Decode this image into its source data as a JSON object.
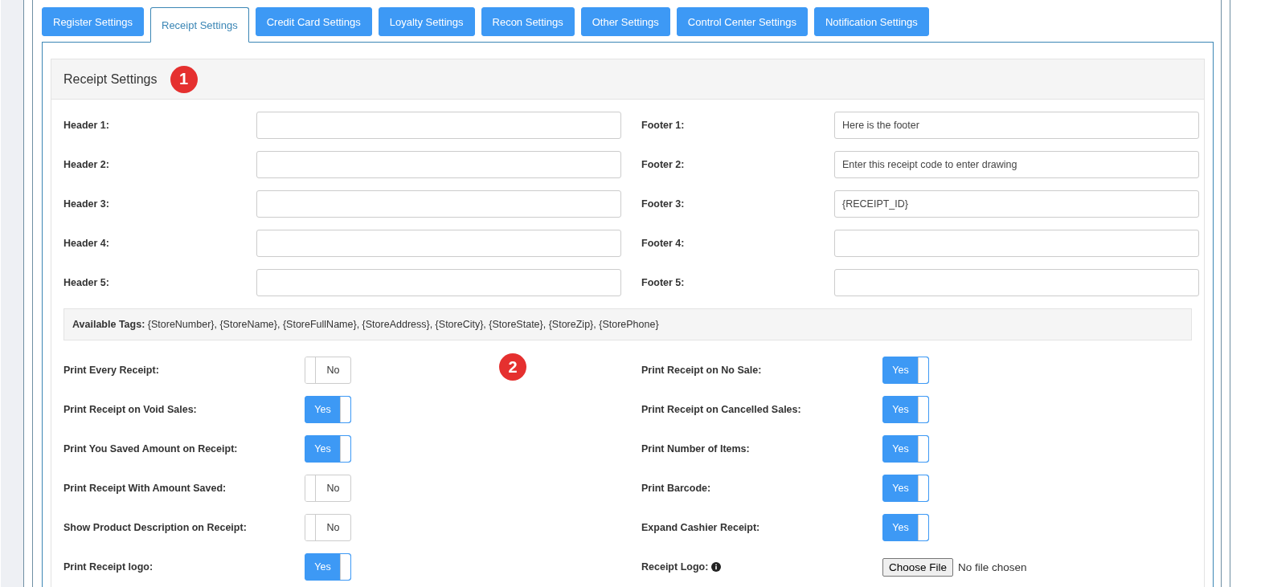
{
  "tabs": [
    {
      "label": "Register Settings",
      "selected": false
    },
    {
      "label": "Receipt Settings",
      "selected": true
    },
    {
      "label": "Credit Card Settings",
      "selected": false
    },
    {
      "label": "Loyalty Settings",
      "selected": false
    },
    {
      "label": "Recon Settings",
      "selected": false
    },
    {
      "label": "Other Settings",
      "selected": false
    },
    {
      "label": "Control Center Settings",
      "selected": false
    },
    {
      "label": "Notification Settings",
      "selected": false
    }
  ],
  "panel": {
    "title": "Receipt Settings",
    "annotations": [
      {
        "number": "1"
      },
      {
        "number": "2"
      }
    ],
    "header_fields": [
      {
        "label": "Header 1:"
      },
      {
        "label": "Header 2:"
      },
      {
        "label": "Header 3:"
      },
      {
        "label": "Header 4:"
      },
      {
        "label": "Header 5:"
      }
    ],
    "footer_fields": [
      {
        "label": "Footer 1:",
        "value": "Here is the footer"
      },
      {
        "label": "Footer 2:",
        "value": "Enter this receipt code to enter drawing"
      },
      {
        "label": "Footer 3:",
        "value": "{RECEIPT_ID}"
      },
      {
        "label": "Footer 4:"
      },
      {
        "label": "Footer 5:"
      }
    ],
    "tags_note": "**Available Tags:** {StoreNumber}, {StoreName}, {StoreFullName}, {StoreAddress}, {StoreCity}, {StoreState}, {StoreZip}, {StorePhone}",
    "left_options": [
      {
        "kind": "toggle",
        "label": "Print Every Receipt:",
        "on": false,
        "text": "No"
      },
      {
        "kind": "toggle",
        "label": "Print Receipt on Void Sales:",
        "on": true,
        "text": "Yes"
      },
      {
        "kind": "toggle",
        "label": "Print You Saved Amount on Receipt:",
        "on": true,
        "text": "Yes"
      },
      {
        "kind": "toggle",
        "label": "Print Receipt With Amount Saved:",
        "on": false,
        "text": "No"
      },
      {
        "kind": "toggle",
        "label": "Show Product Description on Receipt:",
        "on": false,
        "text": "No"
      },
      {
        "kind": "toggle",
        "label": "Print Receipt logo:",
        "on": true,
        "text": "Yes"
      }
    ],
    "right_options": [
      {
        "kind": "toggle",
        "label": "Print Receipt on No Sale:",
        "on": true,
        "text": "Yes"
      },
      {
        "kind": "toggle",
        "label": "Print Receipt on Cancelled Sales:",
        "on": true,
        "text": "Yes"
      },
      {
        "kind": "toggle",
        "label": "Print Number of Items:",
        "on": true,
        "text": "Yes"
      },
      {
        "kind": "toggle",
        "label": "Print Barcode:",
        "on": true,
        "text": "Yes"
      },
      {
        "kind": "toggle",
        "label": "Expand Cashier Receipt:",
        "on": true,
        "text": "Yes"
      },
      {
        "kind": "file",
        "label": "Receipt Logo:",
        "button": "Choose File",
        "status": "No file chosen"
      }
    ]
  }
}
